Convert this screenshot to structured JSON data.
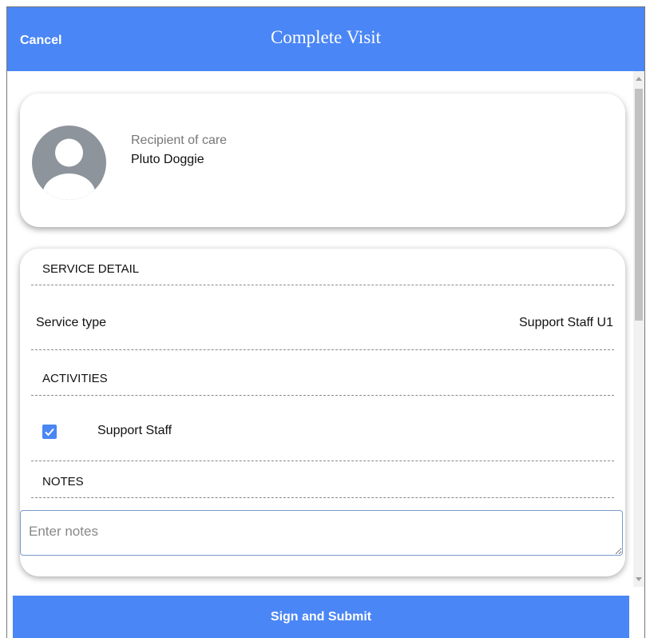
{
  "header": {
    "cancel_label": "Cancel",
    "title": "Complete Visit"
  },
  "recipient": {
    "label": "Recipient of care",
    "name": "Pluto Doggie",
    "avatar_icon": "user-avatar-icon"
  },
  "service_detail": {
    "section_title": "SERVICE DETAIL",
    "service_type_label": "Service type",
    "service_type_value": "Support Staff U1"
  },
  "activities": {
    "section_title": "ACTIVITIES",
    "items": [
      {
        "label": "Support Staff",
        "checked": true
      }
    ]
  },
  "notes": {
    "section_title": "NOTES",
    "placeholder": "Enter notes",
    "value": ""
  },
  "footer": {
    "submit_label": "Sign and Submit"
  },
  "colors": {
    "accent": "#4a86f5",
    "avatar": "#8e949c"
  }
}
